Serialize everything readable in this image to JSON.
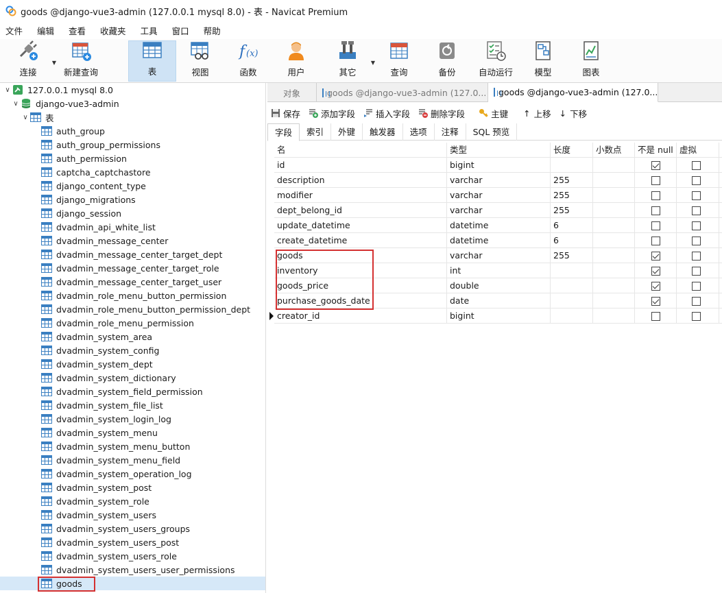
{
  "window": {
    "title": "goods @django-vue3-admin (127.0.0.1 mysql 8.0) - 表 - Navicat Premium"
  },
  "menu": [
    "文件",
    "编辑",
    "查看",
    "收藏夹",
    "工具",
    "窗口",
    "帮助"
  ],
  "toolbar": {
    "connect": "连接",
    "new_query": "新建查询",
    "table": "表",
    "view": "视图",
    "function": "函数",
    "user": "用户",
    "other": "其它",
    "query": "查询",
    "backup": "备份",
    "auto_run": "自动运行",
    "model": "模型",
    "chart": "图表"
  },
  "tree": {
    "connection": "127.0.0.1 mysql 8.0",
    "database": "django-vue3-admin",
    "tables_folder": "表",
    "tables": [
      "auth_group",
      "auth_group_permissions",
      "auth_permission",
      "captcha_captchastore",
      "django_content_type",
      "django_migrations",
      "django_session",
      "dvadmin_api_white_list",
      "dvadmin_message_center",
      "dvadmin_message_center_target_dept",
      "dvadmin_message_center_target_role",
      "dvadmin_message_center_target_user",
      "dvadmin_role_menu_button_permission",
      "dvadmin_role_menu_button_permission_dept",
      "dvadmin_role_menu_permission",
      "dvadmin_system_area",
      "dvadmin_system_config",
      "dvadmin_system_dept",
      "dvadmin_system_dictionary",
      "dvadmin_system_field_permission",
      "dvadmin_system_file_list",
      "dvadmin_system_login_log",
      "dvadmin_system_menu",
      "dvadmin_system_menu_button",
      "dvadmin_system_menu_field",
      "dvadmin_system_operation_log",
      "dvadmin_system_post",
      "dvadmin_system_role",
      "dvadmin_system_users",
      "dvadmin_system_users_groups",
      "dvadmin_system_users_post",
      "dvadmin_system_users_role",
      "dvadmin_system_users_user_permissions",
      "goods"
    ],
    "selected": "goods"
  },
  "tabs": {
    "objects": "对象",
    "tab1": "goods @django-vue3-admin (127.0...",
    "tab2": "goods @django-vue3-admin (127.0...."
  },
  "design_toolbar": {
    "save": "保存",
    "add_field": "添加字段",
    "insert_field": "插入字段",
    "delete_field": "删除字段",
    "primary_key": "主键",
    "move_up": "上移",
    "move_down": "下移"
  },
  "design_tabs": [
    "字段",
    "索引",
    "外键",
    "触发器",
    "选项",
    "注释",
    "SQL 预览"
  ],
  "grid": {
    "headers": {
      "name": "名",
      "type": "类型",
      "length": "长度",
      "decimals": "小数点",
      "not_null": "不是 null",
      "virtual": "虚拟"
    },
    "rows": [
      {
        "name": "id",
        "type": "bigint",
        "length": "",
        "not_null": true,
        "virtual": false
      },
      {
        "name": "description",
        "type": "varchar",
        "length": "255",
        "not_null": false,
        "virtual": false
      },
      {
        "name": "modifier",
        "type": "varchar",
        "length": "255",
        "not_null": false,
        "virtual": false
      },
      {
        "name": "dept_belong_id",
        "type": "varchar",
        "length": "255",
        "not_null": false,
        "virtual": false
      },
      {
        "name": "update_datetime",
        "type": "datetime",
        "length": "6",
        "not_null": false,
        "virtual": false
      },
      {
        "name": "create_datetime",
        "type": "datetime",
        "length": "6",
        "not_null": false,
        "virtual": false
      },
      {
        "name": "goods",
        "type": "varchar",
        "length": "255",
        "not_null": true,
        "virtual": false
      },
      {
        "name": "inventory",
        "type": "int",
        "length": "",
        "not_null": true,
        "virtual": false
      },
      {
        "name": "goods_price",
        "type": "double",
        "length": "",
        "not_null": true,
        "virtual": false
      },
      {
        "name": "purchase_goods_date",
        "type": "date",
        "length": "",
        "not_null": true,
        "virtual": false
      },
      {
        "name": "creator_id",
        "type": "bigint",
        "length": "",
        "not_null": false,
        "virtual": false
      }
    ],
    "current_row": 10
  }
}
